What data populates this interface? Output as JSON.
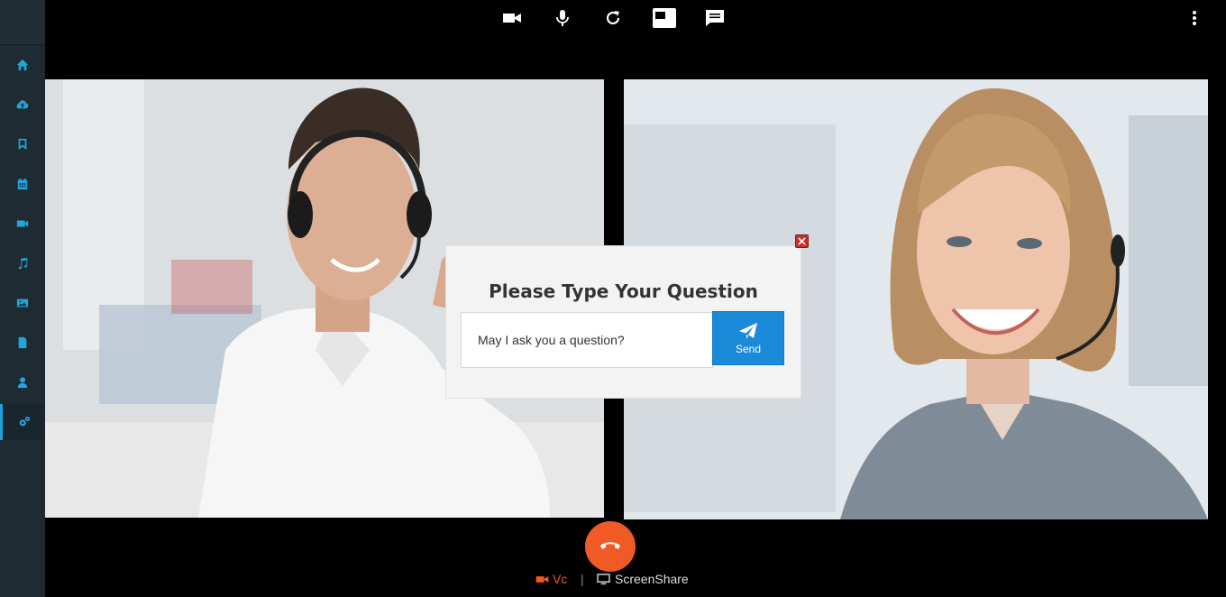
{
  "sidebar": {
    "items": [
      {
        "icon": "home-icon"
      },
      {
        "icon": "cloud-upload-icon"
      },
      {
        "icon": "bookmark-icon"
      },
      {
        "icon": "calendar-icon"
      },
      {
        "icon": "video-camera-icon"
      },
      {
        "icon": "music-icon"
      },
      {
        "icon": "image-icon"
      },
      {
        "icon": "file-icon"
      },
      {
        "icon": "user-icon"
      },
      {
        "icon": "settings-icon",
        "active": true
      }
    ]
  },
  "toolbar": {
    "buttons": [
      "video-camera-icon",
      "microphone-icon",
      "refresh-icon",
      "picture-in-picture-icon",
      "chat-icon"
    ],
    "more_icon": "more-vertical-icon"
  },
  "dialog": {
    "title": "Please Type Your Question",
    "input_value": "May I ask you a question?",
    "send_label": "Send"
  },
  "call_controls": {
    "vc_label": "Vc",
    "separator": "|",
    "screenshare_label": "ScreenShare"
  },
  "colors": {
    "accent": "#23a6d9",
    "hangup": "#f05a24",
    "send": "#1b8ad9",
    "sidebar_bg": "#1e2b33"
  }
}
